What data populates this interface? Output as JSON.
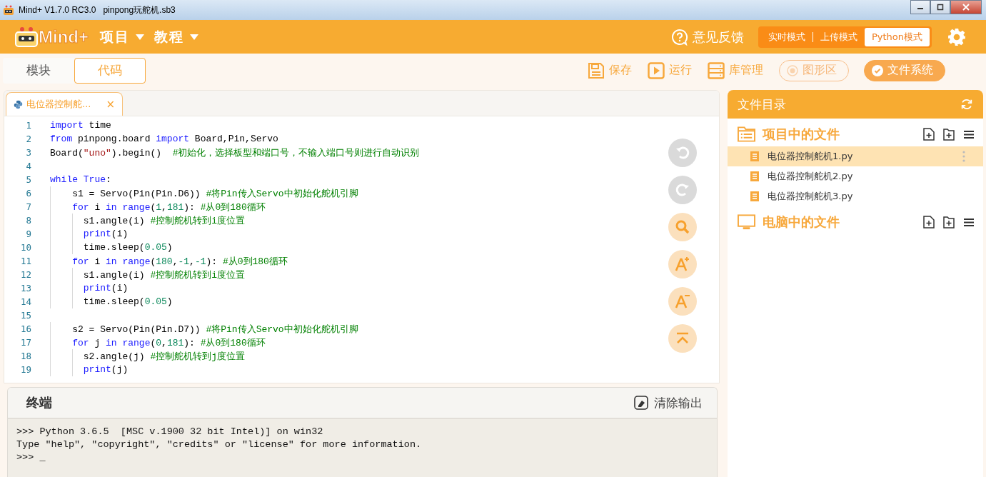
{
  "window": {
    "title": "Mind+ V1.7.0 RC3.0   pinpong玩舵机.sb3"
  },
  "header": {
    "logo": "Mind+",
    "menus": [
      {
        "label": "项目"
      },
      {
        "label": "教程"
      }
    ],
    "feedback": "意见反馈",
    "modes": [
      {
        "label": "实时模式",
        "selected": false
      },
      {
        "label": "上传模式",
        "selected": false
      },
      {
        "label": "Python模式",
        "selected": true
      }
    ]
  },
  "view_tabs": [
    {
      "label": "模块",
      "selected": false
    },
    {
      "label": "代码",
      "selected": true
    }
  ],
  "toolbar": [
    {
      "kind": "save",
      "label": "保存"
    },
    {
      "kind": "run",
      "label": "运行"
    },
    {
      "kind": "library",
      "label": "库管理"
    },
    {
      "kind": "toggle",
      "label": "图形区",
      "on": false
    },
    {
      "kind": "toggle",
      "label": "文件系统",
      "on": true
    }
  ],
  "editor": {
    "file_tab": {
      "label": "电位器控制舵...",
      "close": "×"
    },
    "lines": [
      {
        "number": "1",
        "tokens": [
          {
            "kind": "keyword",
            "text": "import"
          },
          {
            "kind": "plain",
            "text": " time"
          }
        ]
      },
      {
        "number": "2",
        "tokens": [
          {
            "kind": "keyword",
            "text": "from"
          },
          {
            "kind": "plain",
            "text": " pinpong.board "
          },
          {
            "kind": "keyword",
            "text": "import"
          },
          {
            "kind": "plain",
            "text": " Board,Pin,Servo"
          }
        ]
      },
      {
        "number": "3",
        "tokens": [
          {
            "kind": "plain",
            "text": "Board("
          },
          {
            "kind": "string",
            "text": "\"uno\""
          },
          {
            "kind": "plain",
            "text": ").begin()  "
          },
          {
            "kind": "comment",
            "text": "#初始化，选择板型和端口号，不输入端口号则进行自动识别"
          }
        ]
      },
      {
        "number": "4"
      },
      {
        "number": "5",
        "tokens": [
          {
            "kind": "keyword",
            "text": "while"
          },
          {
            "kind": "keyword",
            "text": " True"
          },
          {
            "kind": "plain",
            "text": ":"
          }
        ]
      },
      {
        "number": "6",
        "tokens": [
          {
            "kind": "plain",
            "text": "    s1 = Servo(Pin(Pin.D6)) "
          },
          {
            "kind": "comment",
            "text": "#将Pin传入Servo中初始化舵机引脚"
          }
        ]
      },
      {
        "number": "7",
        "tokens": [
          {
            "kind": "keyword",
            "text": "    for"
          },
          {
            "kind": "plain",
            "text": " i "
          },
          {
            "kind": "keyword",
            "text": "in"
          },
          {
            "kind": "keyword",
            "text": " range"
          },
          {
            "kind": "plain",
            "text": "("
          },
          {
            "kind": "number",
            "text": "1"
          },
          {
            "kind": "plain",
            "text": ","
          },
          {
            "kind": "number",
            "text": "181"
          },
          {
            "kind": "plain",
            "text": "): "
          },
          {
            "kind": "comment",
            "text": "#从0到180循环"
          }
        ]
      },
      {
        "number": "8",
        "tokens": [
          {
            "kind": "plain",
            "text": "      s1.angle(i) "
          },
          {
            "kind": "comment",
            "text": "#控制舵机转到i度位置"
          }
        ]
      },
      {
        "number": "9",
        "tokens": [
          {
            "kind": "keyword",
            "text": "      print"
          },
          {
            "kind": "plain",
            "text": "(i)"
          }
        ]
      },
      {
        "number": "10",
        "tokens": [
          {
            "kind": "plain",
            "text": "      time.sleep("
          },
          {
            "kind": "number",
            "text": "0.05"
          },
          {
            "kind": "plain",
            "text": ")"
          }
        ]
      },
      {
        "number": "11",
        "tokens": [
          {
            "kind": "keyword",
            "text": "    for"
          },
          {
            "kind": "plain",
            "text": " i "
          },
          {
            "kind": "keyword",
            "text": "in"
          },
          {
            "kind": "keyword",
            "text": " range"
          },
          {
            "kind": "plain",
            "text": "("
          },
          {
            "kind": "number",
            "text": "180"
          },
          {
            "kind": "plain",
            "text": ","
          },
          {
            "kind": "number",
            "text": "-1"
          },
          {
            "kind": "plain",
            "text": ","
          },
          {
            "kind": "number",
            "text": "-1"
          },
          {
            "kind": "plain",
            "text": "): "
          },
          {
            "kind": "comment",
            "text": "#从0到180循环"
          }
        ]
      },
      {
        "number": "12",
        "tokens": [
          {
            "kind": "plain",
            "text": "      s1.angle(i) "
          },
          {
            "kind": "comment",
            "text": "#控制舵机转到i度位置"
          }
        ]
      },
      {
        "number": "13",
        "tokens": [
          {
            "kind": "keyword",
            "text": "      print"
          },
          {
            "kind": "plain",
            "text": "(i)"
          }
        ]
      },
      {
        "number": "14",
        "tokens": [
          {
            "kind": "plain",
            "text": "      time.sleep("
          },
          {
            "kind": "number",
            "text": "0.05"
          },
          {
            "kind": "plain",
            "text": ")"
          }
        ]
      },
      {
        "number": "15"
      },
      {
        "number": "16",
        "tokens": [
          {
            "kind": "plain",
            "text": "    s2 = Servo(Pin(Pin.D7)) "
          },
          {
            "kind": "comment",
            "text": "#将Pin传入Servo中初始化舵机引脚"
          }
        ]
      },
      {
        "number": "17",
        "tokens": [
          {
            "kind": "keyword",
            "text": "    for"
          },
          {
            "kind": "plain",
            "text": " j "
          },
          {
            "kind": "keyword",
            "text": "in"
          },
          {
            "kind": "keyword",
            "text": " range"
          },
          {
            "kind": "plain",
            "text": "("
          },
          {
            "kind": "number",
            "text": "0"
          },
          {
            "kind": "plain",
            "text": ","
          },
          {
            "kind": "number",
            "text": "181"
          },
          {
            "kind": "plain",
            "text": "): "
          },
          {
            "kind": "comment",
            "text": "#从0到180循环"
          }
        ]
      },
      {
        "number": "18",
        "tokens": [
          {
            "kind": "plain",
            "text": "      s2.angle(j) "
          },
          {
            "kind": "comment",
            "text": "#控制舵机转到j度位置"
          }
        ]
      },
      {
        "number": "19",
        "tokens": [
          {
            "kind": "keyword",
            "text": "      print"
          },
          {
            "kind": "plain",
            "text": "(j)"
          }
        ]
      }
    ],
    "tools": [
      {
        "kind": "undo",
        "disabled": true
      },
      {
        "kind": "redo",
        "disabled": true
      },
      {
        "kind": "search",
        "disabled": false
      },
      {
        "kind": "font_up",
        "disabled": false
      },
      {
        "kind": "font_down",
        "disabled": false
      },
      {
        "kind": "top",
        "disabled": false
      }
    ]
  },
  "terminal": {
    "title": "终端",
    "clear": "清除输出",
    "lines": [
      ">>> Python 3.6.5  [MSC v.1900 32 bit Intel)] on win32",
      "Type \"help\", \"copyright\", \"credits\" or \"license\" for more information.",
      ">>> _"
    ]
  },
  "files": {
    "title": "文件目录",
    "sections": [
      {
        "kind": "project",
        "title": "项目中的文件",
        "files": [
          {
            "name": "电位器控制舵机1.py",
            "selected": true
          },
          {
            "name": "电位器控制舵机2.py",
            "selected": false
          },
          {
            "name": "电位器控制舵机3.py",
            "selected": false
          }
        ]
      },
      {
        "kind": "computer",
        "title": "电脑中的文件"
      }
    ]
  }
}
